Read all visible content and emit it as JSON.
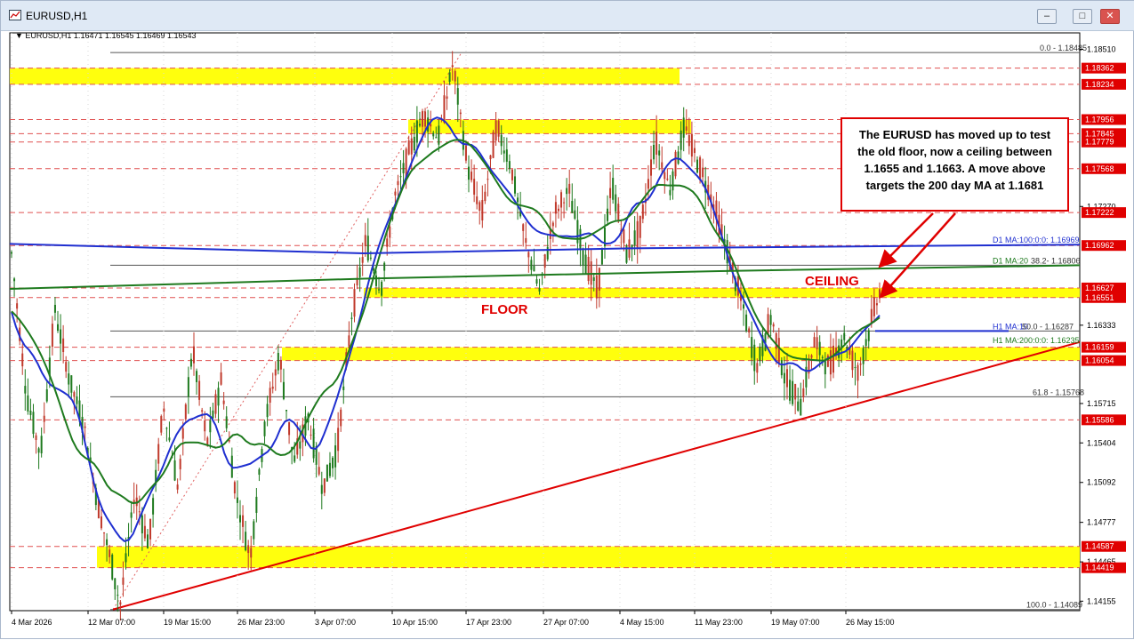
{
  "window": {
    "title": "EURUSD,H1",
    "minimize_icon": "minimize-icon",
    "maximize_icon": "maximize-icon",
    "close_icon": "close-icon"
  },
  "header": {
    "info": "EURUSD,H1  1.16471 1.16545 1.16469 1.16543"
  },
  "annotation": {
    "text": "The EURUSD has moved up to test the old floor, now a ceiling between 1.1655 and 1.1663. A move above targets the 200 day MA at 1.1681",
    "floor_label": "FLOOR",
    "ceiling_label": "CEILING"
  },
  "chart_data": {
    "type": "candlestick",
    "symbol": "EURUSD",
    "timeframe": "H1",
    "ohlc_last": {
      "open": 1.16471,
      "high": 1.16545,
      "low": 1.16469,
      "close": 1.16543
    },
    "ylim": [
      1.1408,
      1.1864
    ],
    "y_ticks": [
      1.1851,
      1.1727,
      1.16333,
      1.15715,
      1.15404,
      1.15092,
      1.14777,
      1.14465,
      1.14155
    ],
    "x_tick_labels": [
      "4 Mar 2026",
      "12 Mar 07:00",
      "19 Mar 15:00",
      "26 Mar 23:00",
      "3 Apr 07:00",
      "10 Apr 15:00",
      "17 Apr 23:00",
      "27 Apr 07:00",
      "4 May 15:00",
      "11 May 23:00",
      "19 May 07:00",
      "26 May 15:00"
    ],
    "price_path": [
      [
        0,
        1.169
      ],
      [
        2,
        1.158
      ],
      [
        4,
        1.153
      ],
      [
        6,
        1.1645
      ],
      [
        8,
        1.159
      ],
      [
        10,
        1.1555
      ],
      [
        12,
        1.149
      ],
      [
        14,
        1.144
      ],
      [
        15,
        1.1412
      ],
      [
        17,
        1.15
      ],
      [
        19,
        1.146
      ],
      [
        21,
        1.157
      ],
      [
        23,
        1.1505
      ],
      [
        25,
        1.1615
      ],
      [
        27,
        1.154
      ],
      [
        29,
        1.159
      ],
      [
        31,
        1.15
      ],
      [
        33,
        1.145
      ],
      [
        35,
        1.1555
      ],
      [
        37,
        1.161
      ],
      [
        39,
        1.1525
      ],
      [
        41,
        1.156
      ],
      [
        43,
        1.1505
      ],
      [
        45,
        1.1535
      ],
      [
        47,
        1.164
      ],
      [
        49,
        1.17
      ],
      [
        51,
        1.166
      ],
      [
        53,
        1.1735
      ],
      [
        55,
        1.177
      ],
      [
        57,
        1.18
      ],
      [
        59,
        1.178
      ],
      [
        61,
        1.184
      ],
      [
        63,
        1.176
      ],
      [
        65,
        1.172
      ],
      [
        67,
        1.179
      ],
      [
        69,
        1.176
      ],
      [
        71,
        1.17
      ],
      [
        73,
        1.166
      ],
      [
        75,
        1.172
      ],
      [
        77,
        1.174
      ],
      [
        79,
        1.169
      ],
      [
        81,
        1.166
      ],
      [
        83,
        1.1745
      ],
      [
        85,
        1.169
      ],
      [
        87,
        1.171
      ],
      [
        89,
        1.178
      ],
      [
        91,
        1.174
      ],
      [
        93,
        1.179
      ],
      [
        95,
        1.176
      ],
      [
        97,
        1.173
      ],
      [
        99,
        1.169
      ],
      [
        101,
        1.165
      ],
      [
        103,
        1.16
      ],
      [
        105,
        1.164
      ],
      [
        107,
        1.159
      ],
      [
        109,
        1.157
      ],
      [
        111,
        1.162
      ],
      [
        113,
        1.16
      ],
      [
        115,
        1.1625
      ],
      [
        117,
        1.1595
      ],
      [
        119,
        1.164
      ],
      [
        120,
        1.166
      ]
    ],
    "moving_averages": [
      {
        "name": "D1 MA:100:0:0",
        "value": 1.16969,
        "color": "#1f2fd0"
      },
      {
        "name": "D1 MA:200",
        "value": 1.16806,
        "color": "#1e7a1e"
      },
      {
        "name": "H1 MA:100",
        "value": 1.16287,
        "color": "#1f2fd0"
      },
      {
        "name": "H1 MA:200:0:0",
        "value": 1.16235,
        "color": "#1e7a1e"
      }
    ],
    "fibonacci": [
      {
        "label": "0.0",
        "value": 1.18485
      },
      {
        "label": "38.2",
        "value": 1.16806
      },
      {
        "label": "50.0",
        "value": 1.16287
      },
      {
        "label": "61.8",
        "value": 1.15768
      },
      {
        "label": "100.0",
        "value": 1.14089
      }
    ],
    "fib_labels": {
      "f0": "0.0 - 1.18485",
      "f382": "38.2- 1.16806",
      "f50": "50.0 - 1.16287",
      "f618": "61.8 - 1.15768",
      "f100": "100.0 - 1.14089"
    },
    "ma_labels": {
      "d1_100": "D1 MA:100:0:0: 1.16969",
      "d1_200": "D1 MA:20",
      "h1_100": "H1 MA:10",
      "h1_200": "H1 MA:200:0:0: 1.16235"
    },
    "price_levels": [
      1.18362,
      1.18234,
      1.17956,
      1.17845,
      1.17779,
      1.17568,
      1.17222,
      1.16962,
      1.16627,
      1.16551,
      1.16159,
      1.16054,
      1.15586,
      1.14587,
      1.14419
    ],
    "yellow_zones": [
      {
        "low": 1.18234,
        "high": 1.18362
      },
      {
        "low": 1.17845,
        "high": 1.17956
      },
      {
        "low": 1.16551,
        "high": 1.16627
      },
      {
        "low": 1.16054,
        "high": 1.16159
      },
      {
        "low": 1.14419,
        "high": 1.14587
      }
    ],
    "trendline": {
      "from": 1.14089,
      "to": 1.162,
      "color": "#e00000"
    },
    "colors": {
      "price": "#1a1a1a",
      "bull": "#1e7a1e",
      "bear": "#c0392b",
      "ma_blue": "#1f2fd0",
      "ma_green": "#1e7a1e",
      "zone": "#ffff00",
      "level_line": "#e05050",
      "label_bg": "#e00000",
      "annotation_arrow": "#e00000"
    }
  }
}
